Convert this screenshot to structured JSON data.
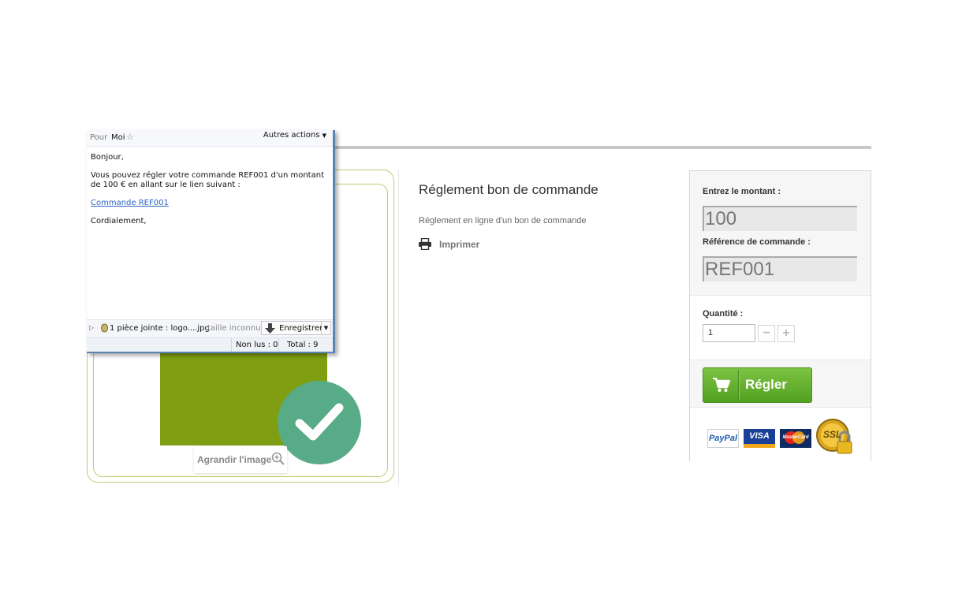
{
  "email": {
    "to_label": "Pour",
    "to_value": "Moi",
    "other_actions": "Autres actions",
    "greeting": "Bonjour,",
    "message": "Vous pouvez régler votre commande REF001 d'un montant de 100 € en allant sur le lien suivant :",
    "link_text": "Commande REF001",
    "closing": "Cordialement,",
    "attachment": {
      "label": "1 pièce jointe : logo....jpg",
      "size": "taille inconnue",
      "save_label": "Enregistrer"
    },
    "status": {
      "unread": "Non lus : 0",
      "total": "Total : 9"
    }
  },
  "product": {
    "zoom_label": "Agrandir l'image",
    "title": "Réglement bon de commande",
    "description": "Réglement en ligne d'un bon de commande",
    "print_label": "Imprimer"
  },
  "payment_box": {
    "amount_label": "Entrez le montant :",
    "amount_value": "100",
    "reference_label": "Référence de commande :",
    "reference_value": "REF001",
    "quantity_label": "Quantité :",
    "quantity_value": "1",
    "minus": "−",
    "plus": "+",
    "pay_button": "Régler",
    "logos": {
      "paypal": "PayPal",
      "visa": "VISA",
      "mastercard": "MasterCard",
      "ssl": "SSL"
    }
  },
  "colors": {
    "accent_green": "#5fb02b",
    "check_green": "#58ab87",
    "link_blue": "#2a63c7"
  }
}
